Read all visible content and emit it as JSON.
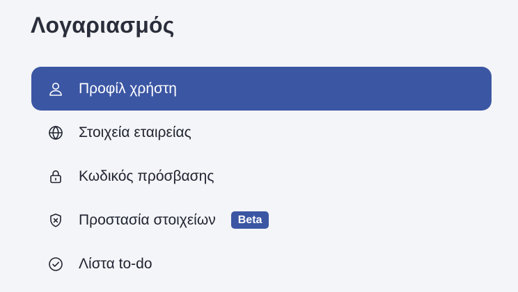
{
  "page": {
    "title": "Λογαριασμός"
  },
  "menu": {
    "items": [
      {
        "label": "Προφίλ χρήστη",
        "icon": "user-icon",
        "active": true
      },
      {
        "label": "Στοιχεία εταιρείας",
        "icon": "globe-icon",
        "active": false
      },
      {
        "label": "Κωδικός πρόσβασης",
        "icon": "lock-icon",
        "active": false
      },
      {
        "label": "Προστασία στοιχείων",
        "icon": "shield-x-icon",
        "active": false,
        "badge": "Beta"
      },
      {
        "label": "Λίστα to-do",
        "icon": "check-circle-icon",
        "active": false
      }
    ]
  },
  "colors": {
    "accent": "#3b56a3",
    "background": "#f4f5f8",
    "text": "#1f2330"
  }
}
